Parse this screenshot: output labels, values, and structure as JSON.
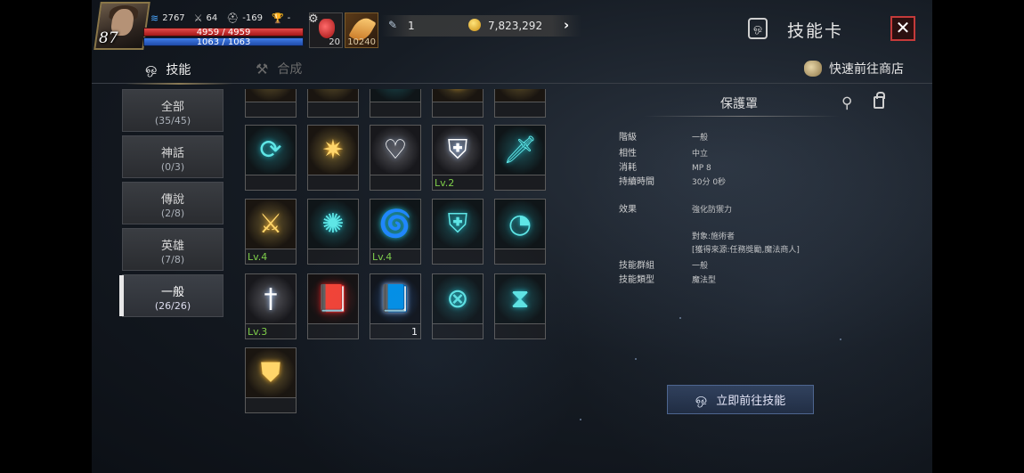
{
  "player": {
    "level": "87",
    "mp_stat": "2767",
    "attack_stat": "64",
    "defense_stat": "-169",
    "trophy_stat": "-",
    "hp": "4959 / 4959",
    "mp": "1063 / 1063"
  },
  "quick_slots": [
    {
      "icon": "red-potion-icon",
      "count": "20"
    },
    {
      "icon": "feather-icon",
      "count": "10240"
    }
  ],
  "currency": {
    "gem_amount": "1",
    "gold_amount": "7,823,292"
  },
  "header": {
    "title": "技能卡",
    "close_label": "✕"
  },
  "tabs": [
    {
      "label": "技能",
      "active": true
    },
    {
      "label": "合成",
      "active": false
    }
  ],
  "shop_link": "快速前往商店",
  "categories": [
    {
      "name": "全部",
      "count": "(35/45)"
    },
    {
      "name": "神話",
      "count": "(0/3)"
    },
    {
      "name": "傳說",
      "count": "(2/8)"
    },
    {
      "name": "英雄",
      "count": "(7/8)"
    },
    {
      "name": "一般",
      "count": "(26/26)",
      "active": true
    }
  ],
  "skills": [
    {
      "icon": "gold-wing-icon",
      "level": "",
      "qty": ""
    },
    {
      "icon": "gold-wave-icon",
      "level": "",
      "qty": ""
    },
    {
      "icon": "teal-arc-icon",
      "level": "",
      "qty": ""
    },
    {
      "icon": "gold-ring-icon",
      "level": "",
      "qty": ""
    },
    {
      "icon": "gold-cross-icon",
      "level": "",
      "qty": ""
    },
    {
      "icon": "teal-cycle-icon",
      "level": "",
      "qty": ""
    },
    {
      "icon": "gold-burst-icon",
      "level": "",
      "qty": ""
    },
    {
      "icon": "winged-heart-icon",
      "level": "",
      "qty": ""
    },
    {
      "icon": "holy-cross-shield-icon",
      "level": "Lv.2",
      "qty": ""
    },
    {
      "icon": "teal-sword-icon",
      "level": "",
      "qty": ""
    },
    {
      "icon": "gold-sword-icon",
      "level": "Lv.4",
      "qty": ""
    },
    {
      "icon": "teal-sun-icon",
      "level": "",
      "qty": ""
    },
    {
      "icon": "teal-whirl-icon",
      "level": "Lv.4",
      "qty": ""
    },
    {
      "icon": "cross-shield-icon",
      "level": "",
      "qty": ""
    },
    {
      "icon": "teal-clock-icon",
      "level": "",
      "qty": ""
    },
    {
      "icon": "sword-ring-icon",
      "level": "Lv.3",
      "qty": ""
    },
    {
      "icon": "red-book-icon",
      "level": "",
      "qty": ""
    },
    {
      "icon": "blue-book-icon",
      "level": "",
      "qty": "1"
    },
    {
      "icon": "teal-cross-ring-icon",
      "level": "",
      "qty": ""
    },
    {
      "icon": "teal-hourglass-icon",
      "level": "",
      "qty": ""
    },
    {
      "icon": "gold-armor-icon",
      "level": "",
      "qty": ""
    }
  ],
  "detail": {
    "title": "保護罩",
    "rows": [
      {
        "key": "階級",
        "value": "一般"
      },
      {
        "key": "相性",
        "value": "中立"
      },
      {
        "key": "消耗",
        "value": "MP 8"
      },
      {
        "key": "持續時間",
        "value": "30分 0秒"
      },
      {
        "key": "效果",
        "value": "強化防禦力"
      },
      {
        "key": "技能群組",
        "value": "一般"
      },
      {
        "key": "技能類型",
        "value": "魔法型"
      }
    ],
    "target": "對象:施術者",
    "source": "[獲得來源:任務獎勵,魔法商人]"
  },
  "go_button": "立即前往技能",
  "colors": {
    "level_text": "#7fcf4a",
    "close_border": "#c43a3a",
    "button_bg": "#2e3e5a"
  }
}
